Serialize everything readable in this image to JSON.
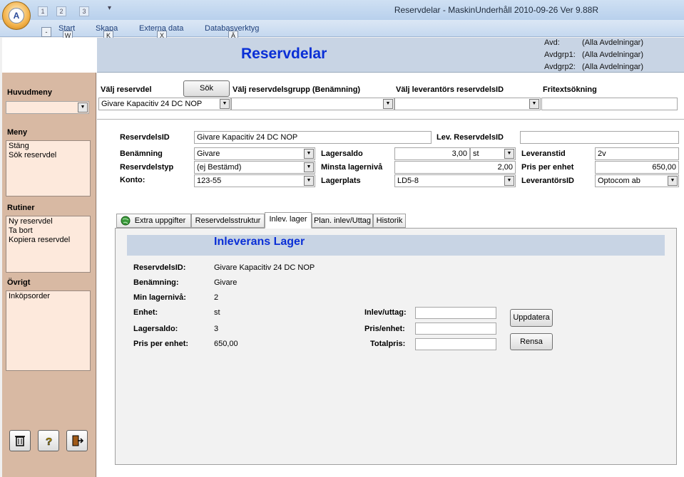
{
  "window": {
    "title": "Reservdelar  -  MaskinUnderhåll 2010-09-26   Ver 9.88R",
    "office_button_letter": "A"
  },
  "quick_access": {
    "keytips": [
      "1",
      "2",
      "3"
    ],
    "customize_label": "▾"
  },
  "ribbon": {
    "tabs": [
      "Start",
      "Skapa",
      "Externa data",
      "Databasverktyg"
    ],
    "tab_keytips": [
      "W",
      "K",
      "X",
      "Ä"
    ],
    "office_keytip": "-"
  },
  "header": {
    "page_title": "Reservdelar",
    "avd_label": "Avd:",
    "avd_value": "(Alla Avdelningar)",
    "avdgrp1_label": "Avdgrp1:",
    "avdgrp1_value": "(Alla Avdelningar)",
    "avdgrp2_label": "Avdgrp2:",
    "avdgrp2_value": "(Alla Avdelningar)"
  },
  "sidebar": {
    "huvudmeny_label": "Huvudmeny",
    "huvudmeny_value": "",
    "meny_label": "Meny",
    "meny_items": [
      "Stäng",
      "Sök reservdel"
    ],
    "rutiner_label": "Rutiner",
    "rutiner_items": [
      "Ny reservdel",
      "Ta bort",
      "Kopiera reservdel"
    ],
    "ovrigt_label": "Övrigt",
    "ovrigt_items": [
      "Inköpsorder"
    ],
    "bottom_icons": [
      "trash-icon",
      "help-icon",
      "exit-icon"
    ]
  },
  "search": {
    "valj_reservdel_label": "Välj reservdel",
    "sok_button": "Sök",
    "valj_grupp_label": "Välj reservdelsgrupp (Benämning)",
    "valj_lev_label": "Välj leverantörs reservdelsID",
    "fritext_label": "Fritextsökning",
    "reservdel_value": "Givare Kapacitiv 24 DC NOP",
    "grupp_value": "",
    "lev_value": "",
    "fritext_value": ""
  },
  "details": {
    "reservdelsid_label": "ReservdelsID",
    "reservdelsid_value": "Givare Kapacitiv 24 DC NOP",
    "lev_reservdelsid_label": "Lev. ReservdelsID",
    "lev_reservdelsid_value": "",
    "benamning_label": "Benämning",
    "benamning_value": "Givare",
    "reservdelstyp_label": "Reservdelstyp",
    "reservdelstyp_value": "(ej Bestämd)",
    "konto_label": "Konto:",
    "konto_value": "123-55",
    "lagersaldo_label": "Lagersaldo",
    "lagersaldo_value": "3,00",
    "lagersaldo_unit": "st",
    "minsta_label": "Minsta lagernivå",
    "minsta_value": "2,00",
    "lagerplats_label": "Lagerplats",
    "lagerplats_value": "LD5-8",
    "leveranstid_label": "Leveranstid",
    "leveranstid_value": "2v",
    "pris_label": "Pris per enhet",
    "pris_value": "650,00",
    "leverantorsid_label": "LeverantörsID",
    "leverantorsid_value": "Optocom ab"
  },
  "tabs": [
    {
      "label": "Extra uppgifter",
      "icon": "globe-icon",
      "active": false
    },
    {
      "label": "Reservdelsstruktur",
      "active": false
    },
    {
      "label": "Inlev. lager",
      "active": true
    },
    {
      "label": "Plan. inlev/Uttag",
      "active": false
    },
    {
      "label": "Historik",
      "active": false
    }
  ],
  "inleverans": {
    "title": "Inleverans Lager",
    "reservdelsid_label": "ReservdelsID:",
    "reservdelsid_value": "Givare Kapacitiv 24 DC NOP",
    "benamning_label": "Benämning:",
    "benamning_value": "Givare",
    "min_label": "Min lagernivå:",
    "min_value": "2",
    "enhet_label": "Enhet:",
    "enhet_value": "st",
    "lagersaldo_label": "Lagersaldo:",
    "lagersaldo_value": "3",
    "pris_label": "Pris per enhet:",
    "pris_value": "650,00",
    "inlev_uttag_label": "Inlev/uttag:",
    "inlev_uttag_value": "",
    "pris_enhet_label": "Pris/enhet:",
    "pris_enhet_value": "",
    "totalpris_label": "Totalpris:",
    "totalpris_value": "",
    "uppdatera_button": "Uppdatera",
    "rensa_button": "Rensa"
  }
}
